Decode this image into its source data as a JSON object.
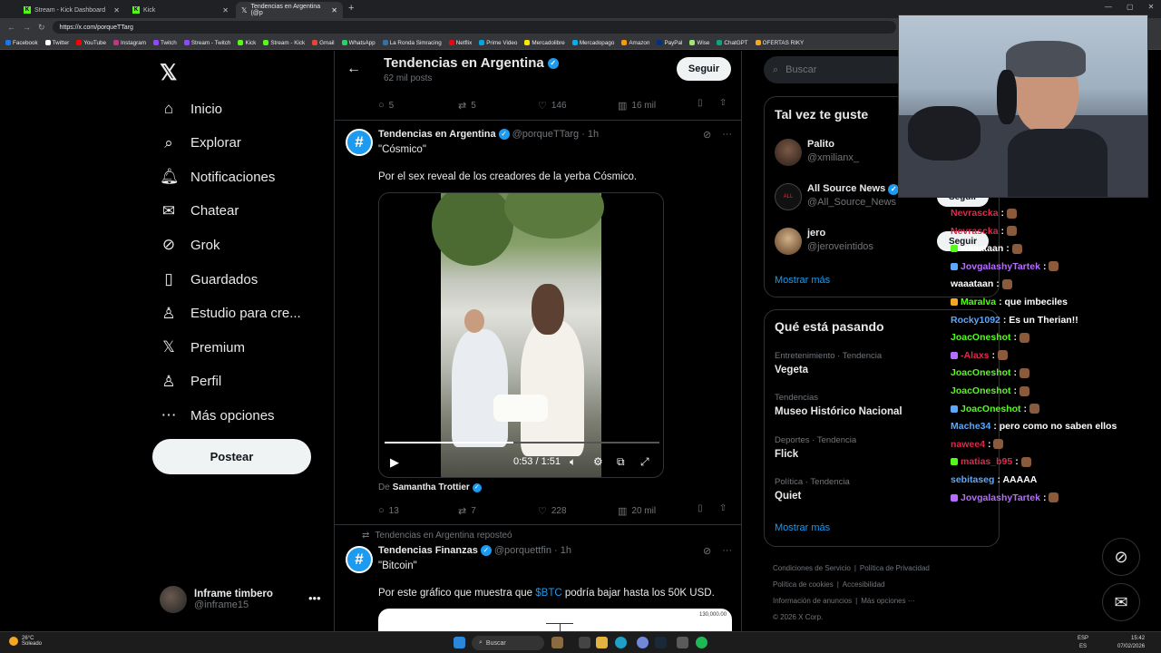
{
  "browser": {
    "tabs": [
      {
        "label": "Stream - Kick Dashboard",
        "active": false
      },
      {
        "label": "Kick",
        "active": false
      },
      {
        "label": "Tendencias en Argentina (@p",
        "active": true
      }
    ],
    "url": "https://x.com/porqueTTarg",
    "bookmarks": [
      "Facebook",
      "Twitter",
      "YouTube",
      "Instagram",
      "Twitch",
      "Stream - Twitch",
      "Kick",
      "Stream - Kick",
      "Gmail",
      "WhatsApp",
      "La Ronda Simracing",
      "Netflix",
      "Prime Video",
      "Mercadolibre",
      "Mercadopago",
      "Amazon",
      "PayPal",
      "Wise",
      "ChatGPT",
      "OFERTAS RIKY"
    ]
  },
  "nav": {
    "items": [
      {
        "label": "Inicio",
        "icon": "home-icon"
      },
      {
        "label": "Explorar",
        "icon": "search-icon"
      },
      {
        "label": "Notificaciones",
        "icon": "bell-icon"
      },
      {
        "label": "Chatear",
        "icon": "mail-icon"
      },
      {
        "label": "Grok",
        "icon": "grok-icon"
      },
      {
        "label": "Guardados",
        "icon": "bookmark-icon"
      },
      {
        "label": "Estudio para cre...",
        "icon": "studio-icon"
      },
      {
        "label": "Premium",
        "icon": "x-icon"
      },
      {
        "label": "Perfil",
        "icon": "user-icon"
      },
      {
        "label": "Más opciones",
        "icon": "more-circle-icon"
      }
    ],
    "post_label": "Postear",
    "profile": {
      "name": "Inframe timbero",
      "handle": "@inframe15"
    }
  },
  "main": {
    "title": "Tendencias en Argentina",
    "subtitle": "62 mil posts",
    "follow_label": "Seguir",
    "top_actions": {
      "replies": "5",
      "reposts": "5",
      "likes": "146",
      "views": "16 mil"
    },
    "tweet1": {
      "name": "Tendencias en Argentina",
      "handle": "@porqueTTarg",
      "time": "· 1h",
      "quote": "\"Cósmico\"",
      "text": "Por el sex reveal de los creadores de la yerba Cósmico.",
      "video_time": "0:53 / 1:51",
      "video_progress": 0.47,
      "credit_prefix": "De",
      "credit_name": "Samantha Trottier",
      "actions": {
        "replies": "13",
        "reposts": "7",
        "likes": "228",
        "views": "20 mil"
      }
    },
    "repost_line": "Tendencias en Argentina reposteó",
    "tweet2": {
      "name": "Tendencias Finanzas",
      "handle": "@porquettfin",
      "time": "· 1h",
      "quote": "\"Bitcoin\"",
      "text_before": "Por este gráfico que muestra que ",
      "cashtag": "$BTC",
      "text_after": " podría bajar hasta los 50K USD.",
      "chart_label": "130,000.00"
    }
  },
  "sidebar": {
    "search_placeholder": "Buscar",
    "who_title": "Tal vez te guste",
    "who": [
      {
        "name": "Palito",
        "handle": "@xmilianx_"
      },
      {
        "name": "All Source News",
        "handle": "@All_Source_News"
      },
      {
        "name": "jero",
        "handle": "@jeroveintidos"
      }
    ],
    "follow_label": "Seguir",
    "show_more": "Mostrar más",
    "trends_title": "Qué está pasando",
    "trends": [
      {
        "context": "Entretenimiento · Tendencia",
        "topic": "Vegeta"
      },
      {
        "context": "Tendencias",
        "topic": "Museo Histórico Nacional"
      },
      {
        "context": "Deportes · Tendencia",
        "topic": "Flick"
      },
      {
        "context": "Política · Tendencia",
        "topic": "Quiet"
      }
    ],
    "footer": [
      "Condiciones de Servicio",
      "Política de Privacidad",
      "Política de cookies",
      "Accesibilidad",
      "Información de anuncios",
      "Más opciones ···",
      "© 2026 X Corp."
    ]
  },
  "chat": [
    {
      "user": "Nevrascka",
      "msg": ":",
      "color": "#e0284a"
    },
    {
      "user": "Nevrascka",
      "msg": ":",
      "color": "#e0284a"
    },
    {
      "user": "waaataan",
      "msg": ":",
      "color": "#ffffff"
    },
    {
      "user": "JovgalashyTartek",
      "msg": ":",
      "color": "#b66dff"
    },
    {
      "user": "waaataan",
      "msg": ":",
      "color": "#ffffff"
    },
    {
      "user": "Maralva",
      "msg": ": que imbeciles",
      "color": "#53fc18"
    },
    {
      "user": "Rocky1092",
      "msg": ": Es un Therian!!",
      "color": "#5aa8ff"
    },
    {
      "user": "JoacOneshot",
      "msg": ":",
      "color": "#53fc18"
    },
    {
      "user": "-Alaxs",
      "msg": ":",
      "color": "#e0284a"
    },
    {
      "user": "JoacOneshot",
      "msg": ":",
      "color": "#53fc18"
    },
    {
      "user": "JoacOneshot",
      "msg": ":",
      "color": "#53fc18"
    },
    {
      "user": "JoacOneshot",
      "msg": ":",
      "color": "#53fc18"
    },
    {
      "user": "Mache34",
      "msg": ": pero como no saben ellos",
      "color": "#5aa8ff"
    },
    {
      "user": "nawee4",
      "msg": ":",
      "color": "#e0284a"
    },
    {
      "user": "matias_b95",
      "msg": ":",
      "color": "#e0284a"
    },
    {
      "user": "sebitaseg",
      "msg": ": AAAAA",
      "color": "#5aa8ff"
    },
    {
      "user": "JovgalashyTartek",
      "msg": ":",
      "color": "#b66dff"
    }
  ],
  "taskbar": {
    "weather_temp": "26°C",
    "weather_desc": "Soleado",
    "search_label": "Buscar",
    "lang": "ESP",
    "lang2": "ES",
    "time": "15:42",
    "date": "07/02/2026"
  }
}
